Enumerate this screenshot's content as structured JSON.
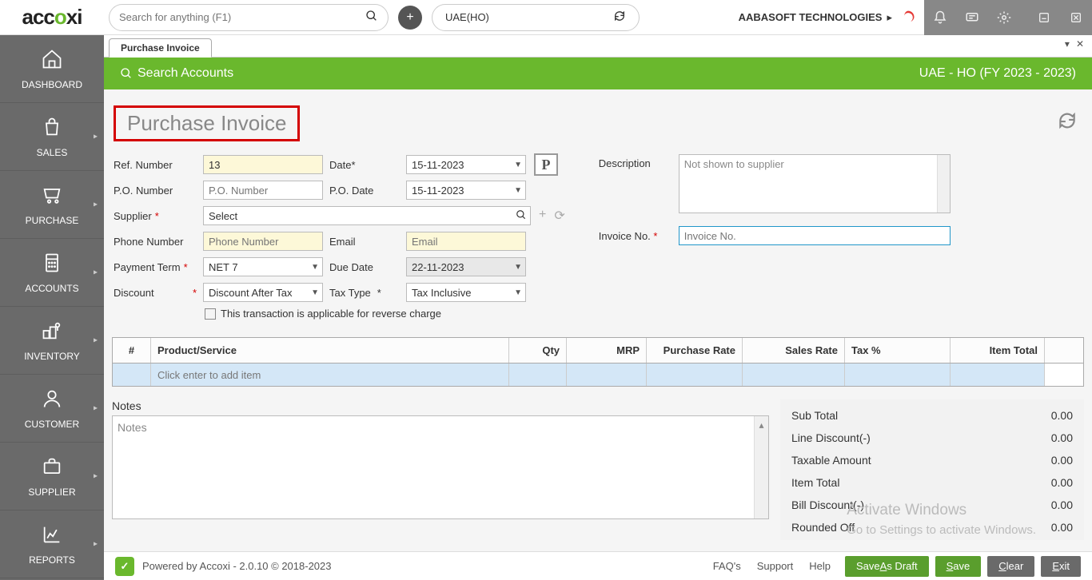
{
  "logo": "accoxi",
  "search": {
    "placeholder": "Search for anything (F1)"
  },
  "org": "UAE(HO)",
  "company": "AABASOFT TECHNOLOGIES",
  "sidebar": [
    {
      "label": "DASHBOARD"
    },
    {
      "label": "SALES"
    },
    {
      "label": "PURCHASE"
    },
    {
      "label": "ACCOUNTS"
    },
    {
      "label": "INVENTORY"
    },
    {
      "label": "CUSTOMER"
    },
    {
      "label": "SUPPLIER"
    },
    {
      "label": "REPORTS"
    }
  ],
  "tab": "Purchase Invoice",
  "greenbar": {
    "search": "Search Accounts",
    "fy": "UAE - HO (FY 2023 - 2023)"
  },
  "title": "Purchase Invoice",
  "form": {
    "ref_lbl": "Ref. Number",
    "ref": "13",
    "date_lbl": "Date",
    "date": "15-11-2023",
    "po_lbl": "P.O. Number",
    "po_ph": "P.O. Number",
    "podate_lbl": "P.O. Date",
    "podate": "15-11-2023",
    "supplier_lbl": "Supplier",
    "supplier": "Select",
    "phone_lbl": "Phone Number",
    "phone_ph": "Phone Number",
    "email_lbl": "Email",
    "email_ph": "Email",
    "term_lbl": "Payment Term",
    "term": "NET 7",
    "due_lbl": "Due Date",
    "due": "22-11-2023",
    "disc_lbl": "Discount",
    "disc": "Discount After Tax",
    "taxtype_lbl": "Tax Type",
    "taxtype": "Tax Inclusive",
    "reverse": "This transaction is applicable for reverse charge",
    "desc_lbl": "Description",
    "desc_ph": "Not shown to supplier",
    "inv_lbl": "Invoice No.",
    "inv_ph": "Invoice No."
  },
  "grid": {
    "heads": {
      "num": "#",
      "prod": "Product/Service",
      "qty": "Qty",
      "mrp": "MRP",
      "prate": "Purchase Rate",
      "srate": "Sales Rate",
      "tax": "Tax %",
      "total": "Item Total"
    },
    "row_ph": "Click enter to add item"
  },
  "notes": {
    "label": "Notes",
    "ph": "Notes"
  },
  "totals": {
    "sub": {
      "l": "Sub Total",
      "v": "0.00"
    },
    "ldisc": {
      "l": "Line Discount(-)",
      "v": "0.00"
    },
    "taxable": {
      "l": "Taxable Amount",
      "v": "0.00"
    },
    "itot": {
      "l": "Item Total",
      "v": "0.00"
    },
    "bdisc": {
      "l": "Bill Discount(-)",
      "v": "0.00"
    },
    "round": {
      "l": "Rounded Off",
      "v": "0.00"
    }
  },
  "watermark": {
    "t": "Activate Windows",
    "s": "Go to Settings to activate Windows."
  },
  "footer": {
    "powered": "Powered by Accoxi - 2.0.10 © 2018-2023",
    "faq": "FAQ's",
    "support": "Support",
    "help": "Help",
    "draft": "Save As Draft",
    "save": "Save",
    "clear": "Clear",
    "exit": "Exit"
  }
}
